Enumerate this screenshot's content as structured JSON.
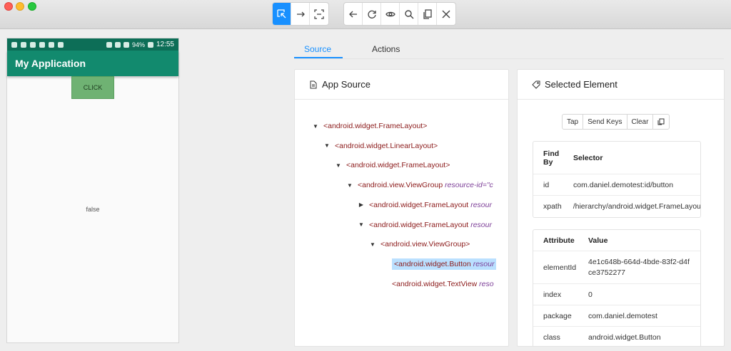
{
  "toolbar": {
    "buttons": [
      {
        "icon": "select-element-icon",
        "active": true
      },
      {
        "icon": "swipe-icon"
      },
      {
        "icon": "tap-coordinates-icon"
      }
    ],
    "nav_buttons": [
      {
        "icon": "back-icon"
      },
      {
        "icon": "refresh-icon"
      },
      {
        "icon": "eye-icon"
      },
      {
        "icon": "search-icon"
      },
      {
        "icon": "copy-icon"
      },
      {
        "icon": "close-icon"
      }
    ]
  },
  "device": {
    "status": {
      "battery": "94%",
      "time": "12:55"
    },
    "app_title": "My Application",
    "button_label": "CLICK",
    "text_value": "false"
  },
  "tabs": [
    {
      "label": "Source",
      "active": true
    },
    {
      "label": "Actions",
      "active": false
    }
  ],
  "source_panel": {
    "title": "App Source",
    "nodes": [
      {
        "tag": "<android.widget.FrameLayout>",
        "attr": "",
        "caret": "down",
        "depth": 0
      },
      {
        "tag": "<android.widget.LinearLayout>",
        "attr": "",
        "caret": "down",
        "depth": 1
      },
      {
        "tag": "<android.widget.FrameLayout>",
        "attr": "",
        "caret": "down",
        "depth": 2
      },
      {
        "tag": "<android.view.ViewGroup",
        "attr": "resource-id=\"c",
        "caret": "down",
        "depth": 3
      },
      {
        "tag": "<android.widget.FrameLayout",
        "attr": "resour",
        "caret": "right",
        "depth": 4
      },
      {
        "tag": "<android.widget.FrameLayout",
        "attr": "resour",
        "caret": "down",
        "depth": 4
      },
      {
        "tag": "<android.view.ViewGroup>",
        "attr": "",
        "caret": "down",
        "depth": 5
      },
      {
        "tag": "<android.widget.Button",
        "attr": "resour",
        "caret": "none",
        "depth": 6,
        "selected": true
      },
      {
        "tag": "<android.widget.TextView",
        "attr": "reso",
        "caret": "none",
        "depth": 6
      }
    ]
  },
  "selected_panel": {
    "title": "Selected Element",
    "actions": [
      "Tap",
      "Send Keys",
      "Clear"
    ],
    "selector_table": {
      "headers": [
        "Find By",
        "Selector"
      ],
      "rows": [
        {
          "find_by": "id",
          "selector": "com.daniel.demotest:id/button"
        },
        {
          "find_by": "xpath",
          "selector": "/hierarchy/android.widget.FrameLayout/and"
        }
      ]
    },
    "attribute_table": {
      "headers": [
        "Attribute",
        "Value"
      ],
      "rows": [
        {
          "attribute": "elementId",
          "value": "4e1c648b-664d-4bde-83f2-d4fce3752277"
        },
        {
          "attribute": "index",
          "value": "0"
        },
        {
          "attribute": "package",
          "value": "com.daniel.demotest"
        },
        {
          "attribute": "class",
          "value": "android.widget.Button"
        }
      ]
    }
  },
  "colors": {
    "accent": "#1890ff",
    "app_bar": "#128a6e",
    "status_bar": "#0d6e57",
    "button": "#6fb273"
  }
}
